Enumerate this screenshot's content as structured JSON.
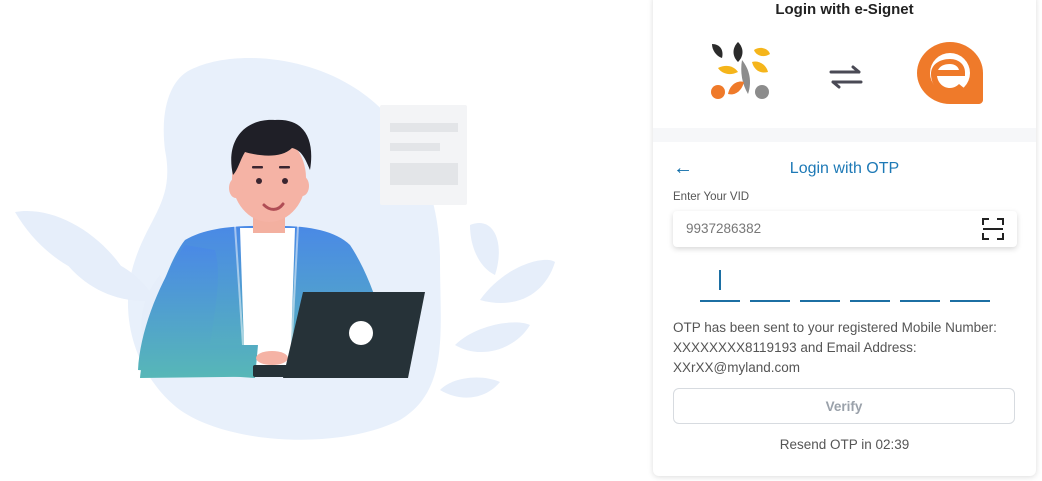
{
  "header": {
    "title": "Login with e-Signet",
    "logos": [
      "partner-logo-icon",
      "swap-arrows-icon",
      "esignet-logo-icon"
    ],
    "colors": {
      "orange": "#ef7a2a",
      "yellow": "#f5b51b",
      "dark": "#2b2b2b",
      "gray": "#8c8c8c"
    }
  },
  "otp_panel": {
    "back_icon": "←",
    "title": "Login with OTP",
    "vid_label": "Enter Your VID",
    "vid_value": "9937286382",
    "scan_icon": "scan-icon",
    "otp_boxes": [
      "",
      "",
      "",
      "",
      "",
      ""
    ],
    "message_lines": [
      "OTP has been sent to your registered Mobile Number:",
      "XXXXXXXX8119193 and Email Address:",
      "XXrXX@myland.com"
    ],
    "verify_label": "Verify",
    "resend_text": "Resend OTP in 02:39"
  },
  "colors": {
    "accent": "#1d79b6",
    "verify_disabled_text": "#9aa1aa"
  }
}
